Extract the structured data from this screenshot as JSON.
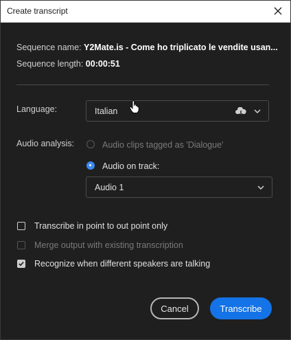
{
  "window": {
    "title": "Create transcript"
  },
  "sequence": {
    "name_label": "Sequence name:",
    "name_value": "Y2Mate.is - Come ho triplicato le vendite usan...",
    "length_label": "Sequence length:",
    "length_value": "00:00:51"
  },
  "language": {
    "label": "Language:",
    "value": "Italian",
    "icon": "cloud-download-icon"
  },
  "audio_analysis": {
    "label": "Audio analysis:",
    "option_dialogue": "Audio clips tagged as 'Dialogue'",
    "option_track": "Audio on track:",
    "track_value": "Audio 1"
  },
  "options": {
    "in_out": "Transcribe in point to out point only",
    "merge": "Merge output with existing transcription",
    "speakers": "Recognize when different speakers are talking"
  },
  "buttons": {
    "cancel": "Cancel",
    "transcribe": "Transcribe"
  },
  "colors": {
    "accent": "#1473e6",
    "background": "#1f1f1f"
  }
}
